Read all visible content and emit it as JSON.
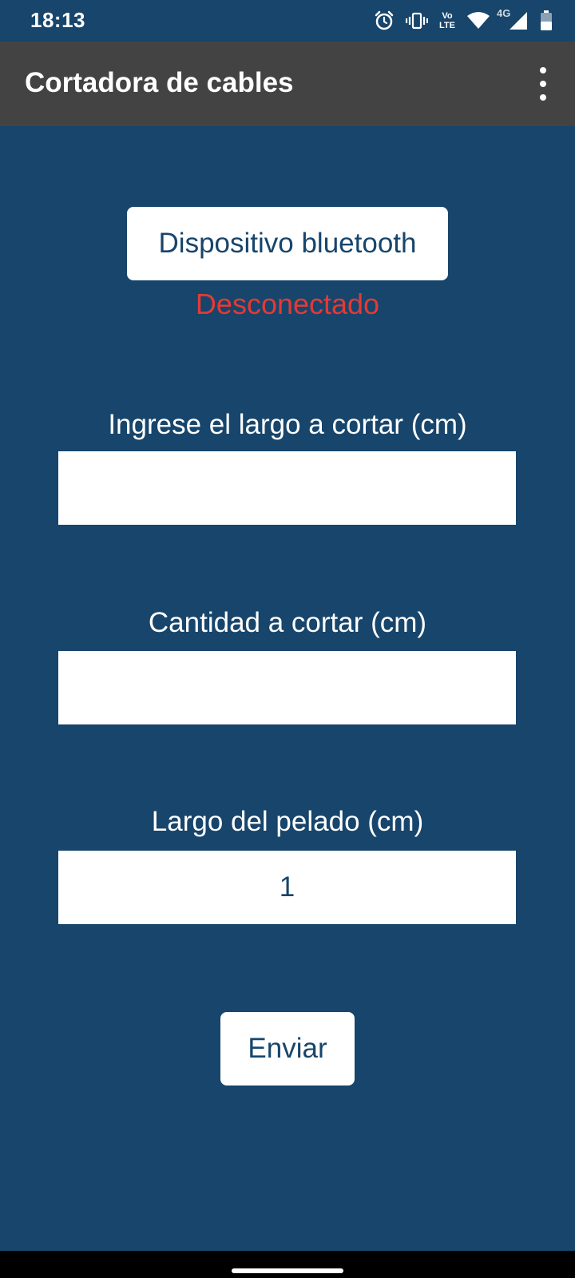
{
  "status_bar": {
    "time": "18:13",
    "volte_top": "Vo",
    "volte_bottom": "LTE",
    "network_type": "4G",
    "icons": [
      "alarm-icon",
      "vibrate-icon",
      "volte-icon",
      "wifi-icon",
      "signal-icon",
      "battery-icon"
    ]
  },
  "app_bar": {
    "title": "Cortadora de cables",
    "menu_icon": "more-vert-icon"
  },
  "bluetooth": {
    "button_label": "Dispositivo bluetooth",
    "status": "Desconectado",
    "status_color": "#e53935"
  },
  "form": {
    "length_label": "Ingrese el largo a cortar (cm)",
    "length_value": "",
    "quantity_label": "Cantidad a cortar (cm)",
    "quantity_value": "",
    "strip_label": "Largo del pelado (cm)",
    "strip_value": "1",
    "send_label": "Enviar"
  },
  "colors": {
    "background": "#17456b",
    "app_bar": "#434343",
    "button_text": "#17456b"
  }
}
